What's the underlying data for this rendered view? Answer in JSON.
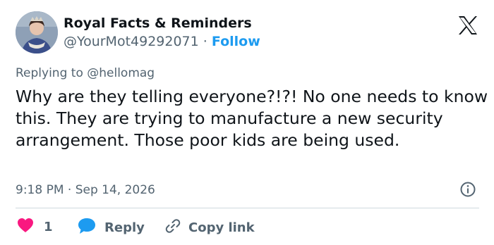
{
  "author": {
    "display_name": "Royal Facts & Reminders",
    "handle": "@YourMot49292071",
    "separator": "·",
    "follow_label": "Follow"
  },
  "reply_context": {
    "prefix": "Replying to",
    "mention": "@hellomag"
  },
  "tweet": {
    "text": "Why are they telling everyone?!?! No one needs to know this. They are trying to manufacture a new security arrangement. Those poor kids are being used.",
    "timestamp": "9:18 PM · Sep 14, 2026"
  },
  "actions": {
    "like_count": "1",
    "reply_label": "Reply",
    "copy_link_label": "Copy link"
  },
  "colors": {
    "like": "#f91880",
    "reply": "#1d9bf0",
    "follow": "#1d9bf0",
    "muted": "#536471"
  },
  "icons": {
    "logo": "x-logo-icon",
    "info": "info-icon",
    "like": "heart-icon",
    "reply": "speech-bubble-icon",
    "copy": "link-icon"
  }
}
